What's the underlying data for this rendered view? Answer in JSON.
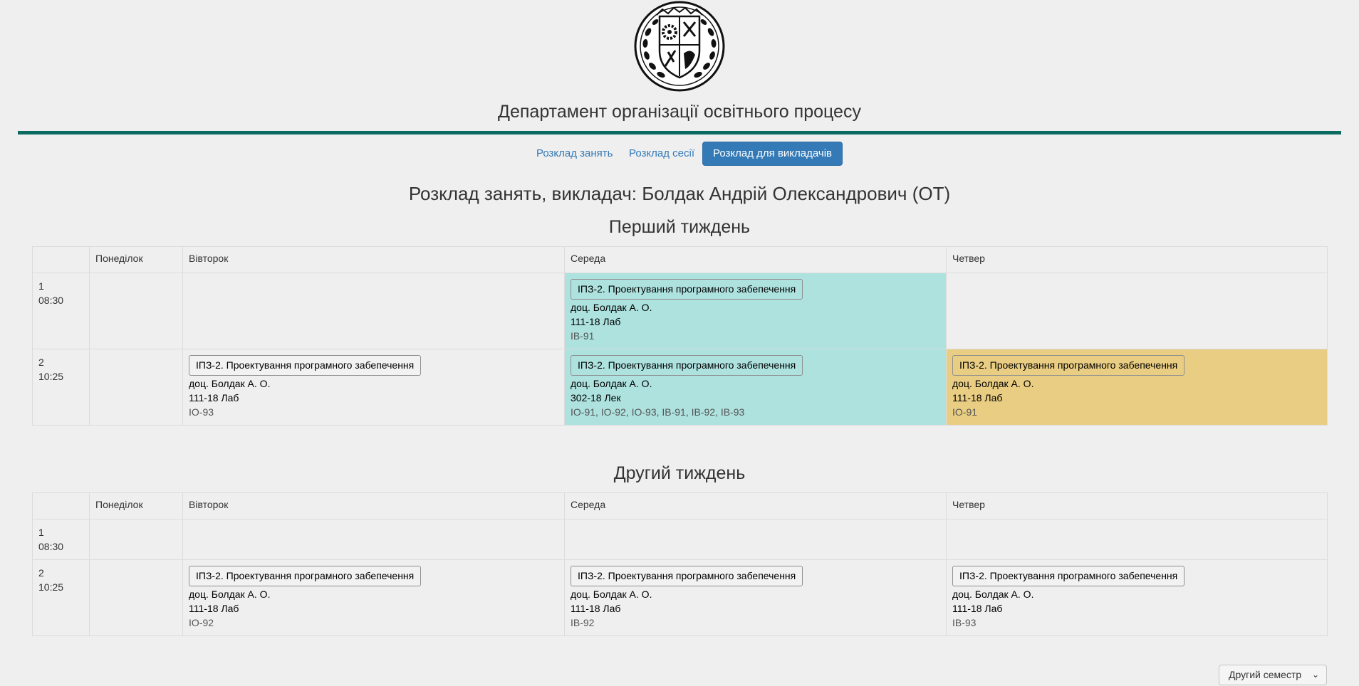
{
  "header": {
    "department_title": "Департамент організації освітнього процесу"
  },
  "nav": {
    "items": [
      {
        "label": "Розклад занять",
        "active": false
      },
      {
        "label": "Розклад сесії",
        "active": false
      },
      {
        "label": "Розклад для викладачів",
        "active": true
      }
    ]
  },
  "page_title": "Розклад занять, викладач: Болдак Андрій Олександрович (ОТ)",
  "colors": {
    "accent_rule": "#0b6b61",
    "lecture_cell": "#ade2df",
    "lab_cell_highlight": "#e9cd82",
    "nav_active": "#337ab7"
  },
  "days": [
    "Понеділок",
    "Вівторок",
    "Середа",
    "Четвер"
  ],
  "weeks": [
    {
      "title": "Перший тиждень",
      "rows": [
        {
          "num": "1",
          "time": "08:30",
          "cells": [
            null,
            null,
            {
              "subject": "ІПЗ-2. Проектування програмного забепечення",
              "teacher": "доц. Болдак А. О.",
              "room": "111-18 Лаб",
              "groups": "ІВ-91",
              "highlight": "cyan"
            },
            null
          ]
        },
        {
          "num": "2",
          "time": "10:25",
          "cells": [
            null,
            {
              "subject": "ІПЗ-2. Проектування програмного забепечення",
              "teacher": "доц. Болдак А. О.",
              "room": "111-18 Лаб",
              "groups": "ІО-93",
              "highlight": ""
            },
            {
              "subject": "ІПЗ-2. Проектування програмного забепечення",
              "teacher": "доц. Болдак А. О.",
              "room": "302-18 Лек",
              "groups": "ІО-91, ІО-92, ІО-93, ІВ-91, ІВ-92, ІВ-93",
              "highlight": "cyan"
            },
            {
              "subject": "ІПЗ-2. Проектування програмного забепечення",
              "teacher": "доц. Болдак А. О.",
              "room": "111-18 Лаб",
              "groups": "ІО-91",
              "highlight": "gold"
            }
          ]
        }
      ]
    },
    {
      "title": "Другий тиждень",
      "rows": [
        {
          "num": "1",
          "time": "08:30",
          "cells": [
            null,
            null,
            null,
            null
          ]
        },
        {
          "num": "2",
          "time": "10:25",
          "cells": [
            null,
            {
              "subject": "ІПЗ-2. Проектування програмного забепечення",
              "teacher": "доц. Болдак А. О.",
              "room": "111-18 Лаб",
              "groups": "ІО-92",
              "highlight": ""
            },
            {
              "subject": "ІПЗ-2. Проектування програмного забепечення",
              "teacher": "доц. Болдак А. О.",
              "room": "111-18 Лаб",
              "groups": "ІВ-92",
              "highlight": ""
            },
            {
              "subject": "ІПЗ-2. Проектування програмного забепечення",
              "teacher": "доц. Болдак А. О.",
              "room": "111-18 Лаб",
              "groups": "ІВ-93",
              "highlight": ""
            }
          ]
        }
      ]
    }
  ],
  "semester_select": {
    "selected": "Другий семестр",
    "chevron_icon": "chevron-down-icon"
  },
  "logo": {
    "icon": "university-emblem-logo"
  }
}
